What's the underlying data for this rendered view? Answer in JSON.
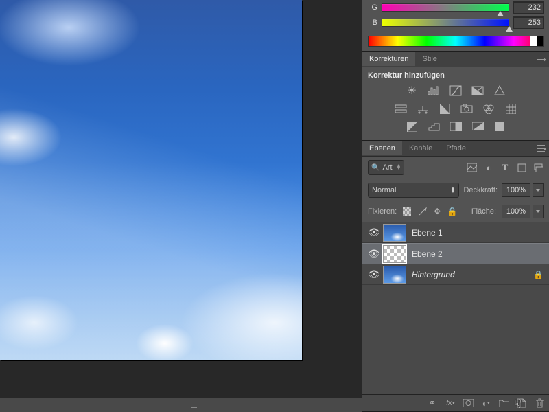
{
  "color_panel": {
    "channels": [
      {
        "label": "G",
        "value": "232"
      },
      {
        "label": "B",
        "value": "253"
      }
    ]
  },
  "panels": {
    "adjustments": {
      "tabs": [
        "Korrekturen",
        "Stile"
      ],
      "active": 0,
      "hint": "Korrektur hinzufügen"
    },
    "layers": {
      "tabs": [
        "Ebenen",
        "Kanäle",
        "Pfade"
      ],
      "active": 0,
      "filter_label": "Art",
      "blend_mode": "Normal",
      "opacity_label": "Deckkraft:",
      "opacity_value": "100%",
      "fill_label": "Fläche:",
      "fill_value": "100%",
      "lock_label": "Fixieren:",
      "layers": [
        {
          "name": "Ebene 1",
          "thumb": "sky",
          "locked": false,
          "selected": false
        },
        {
          "name": "Ebene 2",
          "thumb": "transparent",
          "locked": false,
          "selected": true
        },
        {
          "name": "Hintergrund",
          "thumb": "sky",
          "locked": true,
          "selected": false,
          "italic": true
        }
      ]
    }
  }
}
